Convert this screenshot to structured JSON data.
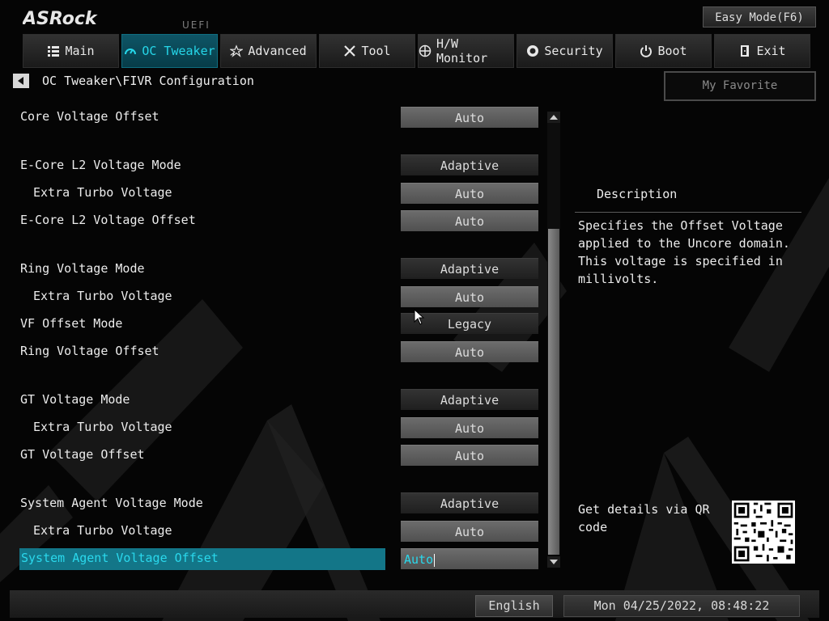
{
  "header": {
    "logo_text": "ASRock",
    "uefi_label": "UEFI",
    "easy_mode_label": "Easy Mode(F6)"
  },
  "tabs": [
    {
      "label": "Main",
      "icon": "list-icon"
    },
    {
      "label": "OC Tweaker",
      "icon": "gauge-icon",
      "active": true
    },
    {
      "label": "Advanced",
      "icon": "star-icon"
    },
    {
      "label": "Tool",
      "icon": "tools-icon"
    },
    {
      "label": "H/W Monitor",
      "icon": "monitor-icon"
    },
    {
      "label": "Security",
      "icon": "shield-icon"
    },
    {
      "label": "Boot",
      "icon": "power-icon"
    },
    {
      "label": "Exit",
      "icon": "exit-icon"
    }
  ],
  "breadcrumb": "OC Tweaker\\FIVR Configuration",
  "my_favorite_label": "My Favorite",
  "settings": [
    {
      "label": "Core Voltage Offset",
      "value": "Auto"
    },
    {
      "label": "E-Core L2 Voltage Mode",
      "value": "Adaptive"
    },
    {
      "label": "Extra Turbo Voltage",
      "value": "Auto"
    },
    {
      "label": "E-Core L2 Voltage Offset",
      "value": "Auto"
    },
    {
      "label": "Ring Voltage Mode",
      "value": "Adaptive"
    },
    {
      "label": "Extra Turbo Voltage",
      "value": "Auto"
    },
    {
      "label": "VF Offset Mode",
      "value": "Legacy"
    },
    {
      "label": "Ring Voltage Offset",
      "value": "Auto"
    },
    {
      "label": "GT Voltage Mode",
      "value": "Adaptive"
    },
    {
      "label": "Extra Turbo Voltage",
      "value": "Auto"
    },
    {
      "label": "GT Voltage Offset",
      "value": "Auto"
    },
    {
      "label": "System Agent Voltage Mode",
      "value": "Adaptive"
    },
    {
      "label": "Extra Turbo Voltage",
      "value": "Auto"
    },
    {
      "label": "System Agent Voltage Offset",
      "value": "Auto",
      "selected": true
    }
  ],
  "description": {
    "title": "Description",
    "text": "Specifies the Offset Voltage applied to the Uncore domain. This voltage is specified in millivolts.",
    "qr_text": "Get details via QR code"
  },
  "footer": {
    "language": "English",
    "datetime": "Mon 04/25/2022, 08:48:22"
  },
  "colors": {
    "accent": "#25d6e8",
    "highlight": "#137688"
  }
}
